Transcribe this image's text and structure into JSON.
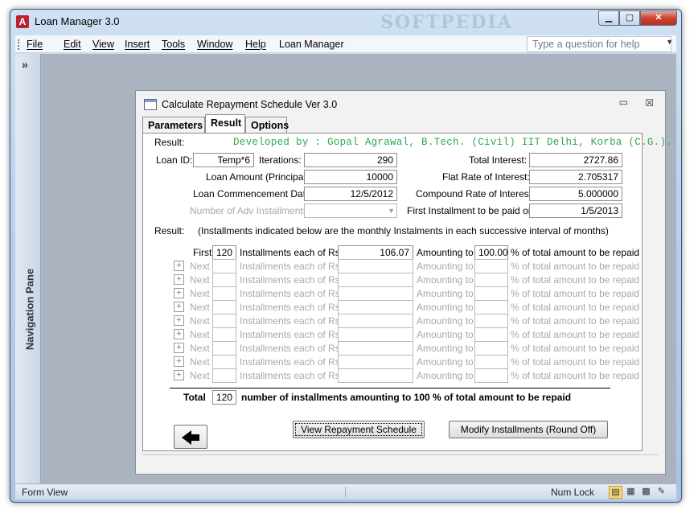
{
  "window": {
    "title": "Loan Manager 3.0",
    "watermark": "SOFTPEDIA",
    "app_icon": "A"
  },
  "menu": {
    "items": [
      "File",
      "Edit",
      "View",
      "Insert",
      "Tools",
      "Window",
      "Help",
      "Loan Manager"
    ],
    "ask_placeholder": "Type a question for help"
  },
  "nav_pane": {
    "label": "Navigation Pane",
    "chevron": "»"
  },
  "form": {
    "title": "Calculate Repayment Schedule Ver 3.0",
    "tabs": [
      "Parameters",
      "Result",
      "Options"
    ],
    "active_tab": "Result",
    "result_label": "Result:",
    "developer": "Developed by : Gopal Agrawal, B.Tech. (Civil)  IIT Delhi, Korba (C.G.).",
    "loan_id_label": "Loan ID:",
    "loan_id": "Temp*6",
    "iterations_label": "Iterations:",
    "iterations": "290",
    "loan_amount_label": "Loan Amount (Principal):",
    "loan_amount": "10000",
    "commencement_label": "Loan Commencement Date:",
    "commencement_date": "12/5/2012",
    "adv_installments_label": "Number of Adv Installments:",
    "total_interest_label": "Total Interest:",
    "total_interest": "2727.86",
    "flat_rate_label": "Flat Rate of Interest:",
    "flat_rate": "2.705317",
    "compound_rate_label": "Compound Rate of Interest:",
    "compound_rate": "5.000000",
    "first_installment_label": "First Installment to be paid on:",
    "first_installment_date": "1/5/2013",
    "result_note_label": "Result:",
    "result_note": "(Installments indicated below are the monthly Instalments in each successive interval of months)",
    "first_row": {
      "first_label": "First",
      "count": "120",
      "installments_label": "Installments each of Rs.",
      "amount": "106.07",
      "amounting_label": "Amounting to",
      "percent": "100.00",
      "percent_label": "% of total amount to be repaid"
    },
    "next_rows": {
      "plus": "+",
      "next_label": "Next",
      "installments_label": "Installments each of Rs.",
      "amounting_label": "Amounting to",
      "percent_label": "% of total amount to be repaid",
      "count": 9
    },
    "total_label": "Total",
    "total_count": "120",
    "total_text": "number of installments amounting to 100 % of total amount to be repaid",
    "view_button": "View Repayment Schedule",
    "modify_button": "Modify Installments (Round Off)"
  },
  "status": {
    "left": "Form View",
    "right": "Num Lock"
  }
}
